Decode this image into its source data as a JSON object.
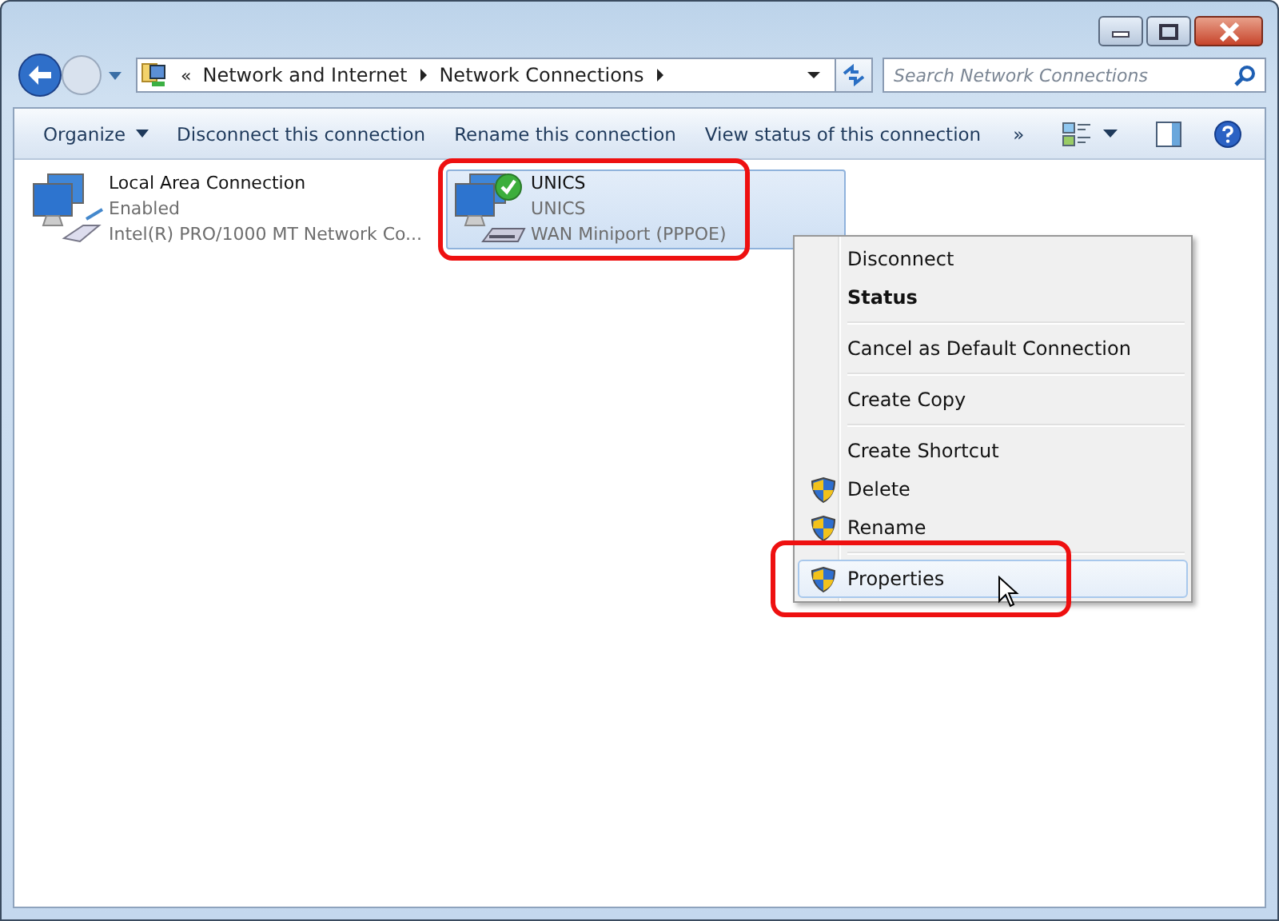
{
  "address_bar": {
    "overflow": "«",
    "crumbs": [
      "Network and Internet",
      "Network Connections"
    ]
  },
  "search": {
    "placeholder": "Search Network Connections"
  },
  "toolbar": {
    "buttons": [
      {
        "label": "Organize",
        "dropdown": true
      },
      {
        "label": "Disconnect this connection",
        "dropdown": false
      },
      {
        "label": "Rename this connection",
        "dropdown": false
      },
      {
        "label": "View status of this connection",
        "dropdown": false
      }
    ],
    "more": "»"
  },
  "connections": [
    {
      "kind": "lan",
      "name": "Local Area Connection",
      "status": "Enabled",
      "device": "Intel(R) PRO/1000 MT Network Co...",
      "selected": false,
      "connected": false,
      "highlighted": false
    },
    {
      "kind": "pppoe",
      "name": "UNICS",
      "status": "UNICS",
      "device": "WAN Miniport (PPPOE)",
      "selected": true,
      "connected": true,
      "highlighted": true
    }
  ],
  "context_menu": {
    "groups": [
      [
        {
          "label": "Disconnect",
          "default": false,
          "shield": false,
          "selected": false,
          "highlighted": false
        },
        {
          "label": "Status",
          "default": true,
          "shield": false,
          "selected": false,
          "highlighted": false
        }
      ],
      [
        {
          "label": "Cancel as Default Connection",
          "default": false,
          "shield": false,
          "selected": false,
          "highlighted": false
        }
      ],
      [
        {
          "label": "Create Copy",
          "default": false,
          "shield": false,
          "selected": false,
          "highlighted": false
        }
      ],
      [
        {
          "label": "Create Shortcut",
          "default": false,
          "shield": false,
          "selected": false,
          "highlighted": false
        },
        {
          "label": "Delete",
          "default": false,
          "shield": true,
          "selected": false,
          "highlighted": false
        },
        {
          "label": "Rename",
          "default": false,
          "shield": true,
          "selected": false,
          "highlighted": false
        }
      ],
      [
        {
          "label": "Properties",
          "default": false,
          "shield": true,
          "selected": true,
          "highlighted": true
        }
      ]
    ]
  }
}
